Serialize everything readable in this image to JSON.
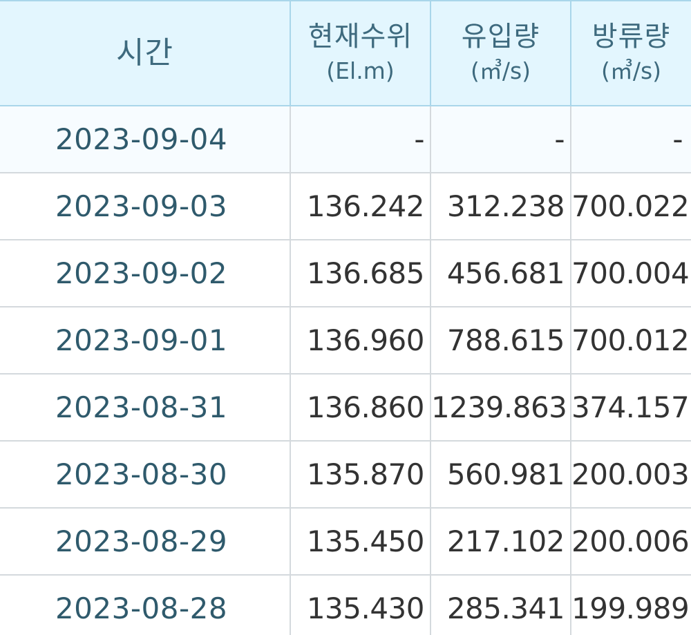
{
  "table": {
    "headers": [
      {
        "title": "시간",
        "unit": ""
      },
      {
        "title": "현재수위",
        "unit": "(El.m)"
      },
      {
        "title": "유입량",
        "unit": "(㎥/s)"
      },
      {
        "title": "방류량",
        "unit": "(㎥/s)"
      }
    ],
    "rows": [
      {
        "date": "2023-09-04",
        "level": "-",
        "inflow": "-",
        "outflow": "-"
      },
      {
        "date": "2023-09-03",
        "level": "136.242",
        "inflow": "312.238",
        "outflow": "700.022"
      },
      {
        "date": "2023-09-02",
        "level": "136.685",
        "inflow": "456.681",
        "outflow": "700.004"
      },
      {
        "date": "2023-09-01",
        "level": "136.960",
        "inflow": "788.615",
        "outflow": "700.012"
      },
      {
        "date": "2023-08-31",
        "level": "136.860",
        "inflow": "1239.863",
        "outflow": "374.157"
      },
      {
        "date": "2023-08-30",
        "level": "135.870",
        "inflow": "560.981",
        "outflow": "200.003"
      },
      {
        "date": "2023-08-29",
        "level": "135.450",
        "inflow": "217.102",
        "outflow": "200.006"
      },
      {
        "date": "2023-08-28",
        "level": "135.430",
        "inflow": "285.341",
        "outflow": "199.989"
      }
    ]
  },
  "colors": {
    "header_bg": "#e3f6fe",
    "header_text": "#3e6a7e",
    "header_border": "#a9d6ea",
    "row_border": "#d4d9dd",
    "cell_text": "#333333",
    "date_text": "#2f5a6c"
  }
}
